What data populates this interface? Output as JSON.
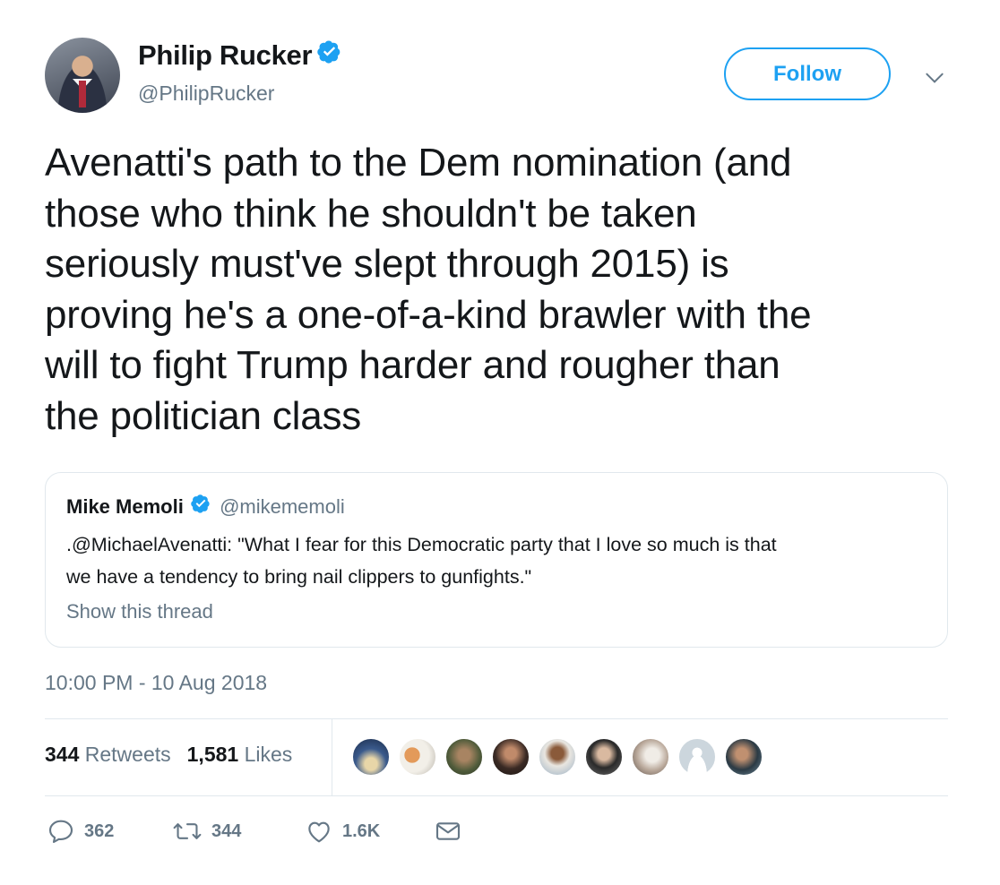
{
  "author": {
    "name": "Philip Rucker",
    "handle": "@PhilipRucker",
    "verified": true
  },
  "follow_label": "Follow",
  "tweet_lines": [
    "Avenatti's path to the Dem nomination (and",
    "those who think he shouldn't be taken",
    "seriously must've slept through 2015) is",
    "proving he's a one-of-a-kind brawler with the",
    "will to fight Trump harder and rougher than",
    "the politician class"
  ],
  "quoted": {
    "name": "Mike Memoli",
    "handle": "@mikememoli",
    "verified": true,
    "text_lines": [
      ".@MichaelAvenatti: \"What I fear for this Democratic party that I love so much is that",
      "we have a tendency to bring nail clippers to gunfights.\""
    ],
    "show_thread": "Show this thread"
  },
  "timestamp": "10:00 PM - 10 Aug 2018",
  "stats": {
    "retweets_count": "344",
    "retweets_label": "Retweets",
    "likes_count": "1,581",
    "likes_label": "Likes"
  },
  "liker_avatars": 9,
  "actions": {
    "replies": "362",
    "retweets": "344",
    "likes": "1.6K"
  },
  "colors": {
    "accent": "#1da1f2",
    "muted": "#657786",
    "text": "#14171a",
    "border": "#e1e8ed"
  }
}
